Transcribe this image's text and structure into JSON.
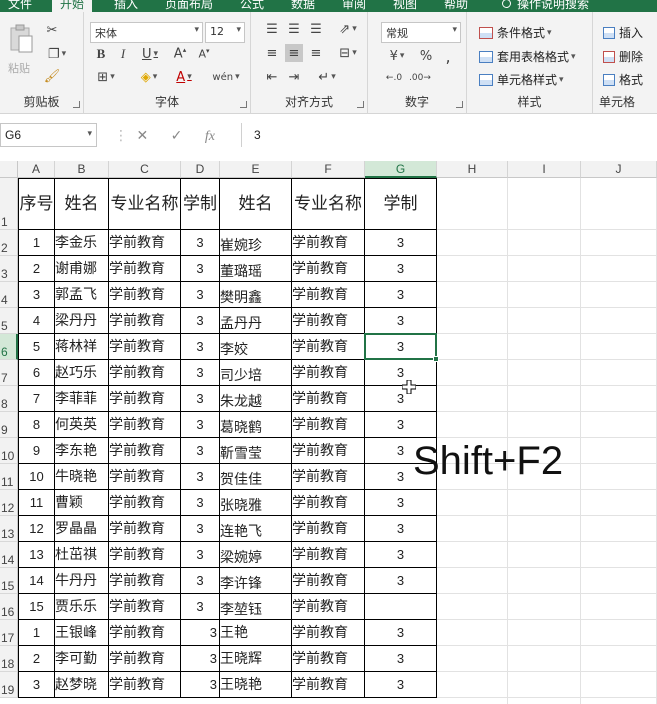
{
  "ribbon": {
    "tabs": [
      "文件",
      "开始",
      "插入",
      "页面布局",
      "公式",
      "数据",
      "审阅",
      "视图",
      "帮助"
    ],
    "active_tab": "开始",
    "tell_me": "操作说明搜索",
    "groups": {
      "clipboard": {
        "label": "剪贴板",
        "paste": "粘贴"
      },
      "font": {
        "label": "字体",
        "font_name": "宋体",
        "font_size": "12"
      },
      "alignment": {
        "label": "对齐方式"
      },
      "number": {
        "label": "数字",
        "format": "常规"
      },
      "styles": {
        "label": "样式",
        "conditional": "条件格式",
        "table": "套用表格格式",
        "cell_styles": "单元格样式"
      },
      "cells": {
        "label": "单元格",
        "insert": "插入",
        "delete": "删除",
        "format": "格式"
      }
    }
  },
  "formula_bar": {
    "name_box": "G6",
    "value": "3"
  },
  "columns": [
    "A",
    "B",
    "C",
    "D",
    "E",
    "F",
    "G",
    "H",
    "I",
    "J"
  ],
  "selected_column": "G",
  "selected_row": "6",
  "row_numbers": [
    "1",
    "2",
    "3",
    "4",
    "5",
    "6",
    "7",
    "8",
    "9",
    "10",
    "11",
    "12",
    "13",
    "14",
    "15",
    "16",
    "17",
    "18",
    "19"
  ],
  "header": [
    "序号",
    "姓名",
    "专业名称",
    "学制",
    "姓名",
    "专业名称",
    "学制"
  ],
  "rows": [
    [
      "1",
      "李金乐",
      "学前教育",
      "3",
      "崔婉珍",
      "学前教育",
      "3"
    ],
    [
      "2",
      "谢甫娜",
      "学前教育",
      "3",
      "董璐瑶",
      "学前教育",
      "3"
    ],
    [
      "3",
      "郭孟飞",
      "学前教育",
      "3",
      "樊明鑫",
      "学前教育",
      "3"
    ],
    [
      "4",
      "梁丹丹",
      "学前教育",
      "3",
      "孟丹丹",
      "学前教育",
      "3"
    ],
    [
      "5",
      "蒋林祥",
      "学前教育",
      "3",
      "李姣",
      "学前教育",
      "3"
    ],
    [
      "6",
      "赵巧乐",
      "学前教育",
      "3",
      "司少培",
      "学前教育",
      "3"
    ],
    [
      "7",
      "李菲菲",
      "学前教育",
      "3",
      "朱龙越",
      "学前教育",
      "3"
    ],
    [
      "8",
      "何英英",
      "学前教育",
      "3",
      "葛晓鹤",
      "学前教育",
      "3"
    ],
    [
      "9",
      "李东艳",
      "学前教育",
      "3",
      "靳雪莹",
      "学前教育",
      "3"
    ],
    [
      "10",
      "牛晓艳",
      "学前教育",
      "3",
      "贺佳佳",
      "学前教育",
      "3"
    ],
    [
      "11",
      "曹颖",
      "学前教育",
      "3",
      "张晓雅",
      "学前教育",
      "3"
    ],
    [
      "12",
      "罗晶晶",
      "学前教育",
      "3",
      "连艳飞",
      "学前教育",
      "3"
    ],
    [
      "13",
      "杜茁祺",
      "学前教育",
      "3",
      "梁婉婷",
      "学前教育",
      "3"
    ],
    [
      "14",
      "牛丹丹",
      "学前教育",
      "3",
      "李许锋",
      "学前教育",
      "3"
    ],
    [
      "15",
      "贾乐乐",
      "学前教育",
      "3",
      "李堃钰",
      "学前教育",
      ""
    ],
    [
      "1",
      "王银峰",
      "学前教育",
      "3",
      "王艳",
      "学前教育",
      "3"
    ],
    [
      "2",
      "李可勤",
      "学前教育",
      "3",
      "王晓辉",
      "学前教育",
      "3"
    ],
    [
      "3",
      "赵梦晓",
      "学前教育",
      "3",
      "王晓艳",
      "学前教育",
      "3"
    ]
  ],
  "overlay_text": "Shift+F2"
}
